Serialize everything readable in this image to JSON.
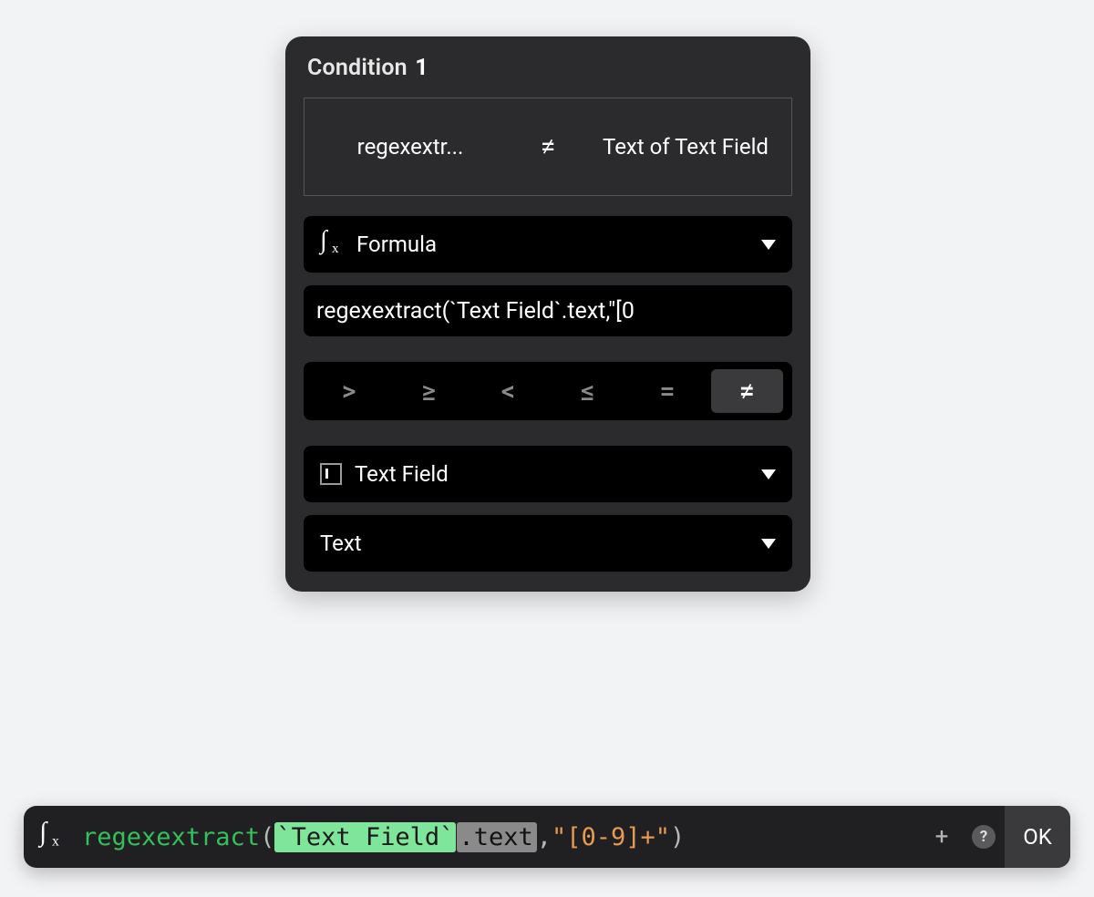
{
  "panel": {
    "title_prefix": "Condition",
    "title_number": "1",
    "summary": {
      "left": "regexextr...",
      "operator": "≠",
      "right": "Text of Text Field"
    },
    "type_select": {
      "label": "Formula"
    },
    "formula_preview": "regexextract(`Text Field`.text,\"[0",
    "operators": [
      {
        "glyph": ">",
        "name": "greater-than",
        "selected": false
      },
      {
        "glyph": "≥",
        "name": "greater-than-or-equal",
        "selected": false
      },
      {
        "glyph": "<",
        "name": "less-than",
        "selected": false
      },
      {
        "glyph": "≤",
        "name": "less-than-or-equal",
        "selected": false
      },
      {
        "glyph": "=",
        "name": "equal",
        "selected": false
      },
      {
        "glyph": "≠",
        "name": "not-equal",
        "selected": true
      }
    ],
    "target_select": {
      "label": "Text Field"
    },
    "property_select": {
      "label": "Text"
    }
  },
  "formula_bar": {
    "tokens": {
      "func": "regexextract",
      "open": "(",
      "ref": "`Text Field`",
      "dot": ".",
      "prop": "text",
      "comma": ",",
      "str": "\"[0-9]+\"",
      "close": ")"
    },
    "ok_label": "OK",
    "plus_label": "+",
    "help_label": "?"
  }
}
